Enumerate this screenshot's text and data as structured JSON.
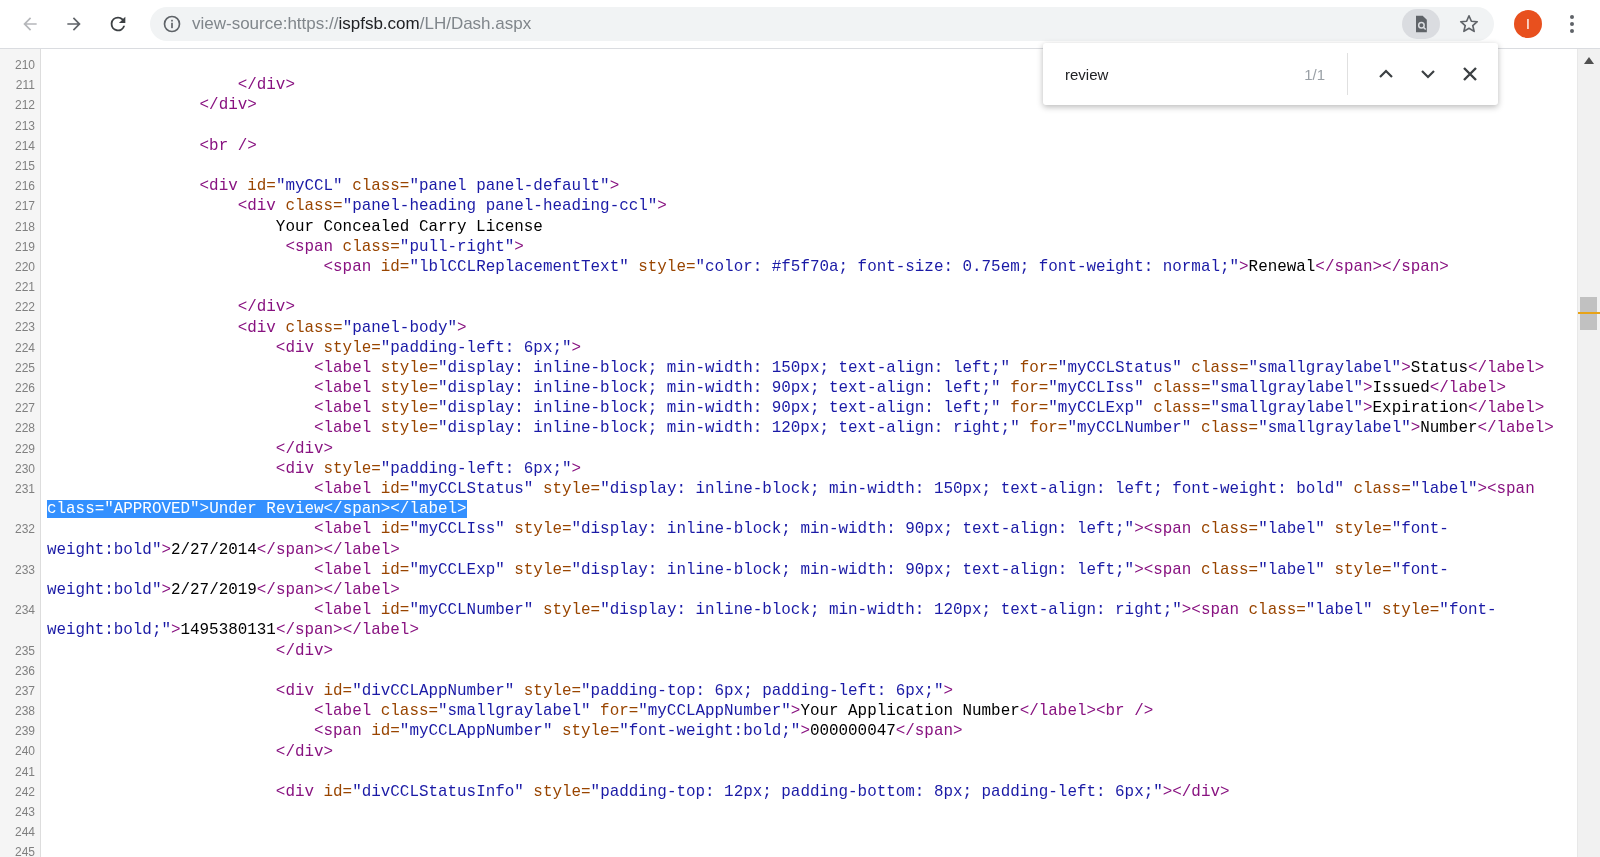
{
  "toolbar": {
    "url": {
      "prefix": "view-source:https://",
      "host": "ispfsb.com",
      "path": "/LH/Dash.aspx"
    },
    "back_disabled": true,
    "forward_disabled": false,
    "avatar": "I"
  },
  "find_bar": {
    "value": "review",
    "count": "1/1"
  },
  "source": {
    "lines": [
      {
        "number": "210"
      },
      {
        "number": "211",
        "rows": [
          {
            "highlighted": false,
            "tokens": [
              {
                "kind": "tag",
                "text": "                    </div>"
              }
            ]
          }
        ]
      },
      {
        "number": "212",
        "rows": [
          {
            "highlighted": false,
            "tokens": [
              {
                "kind": "tag",
                "text": "                </div>"
              }
            ]
          }
        ]
      },
      {
        "number": "213"
      },
      {
        "number": "214",
        "rows": [
          {
            "highlighted": false,
            "tokens": [
              {
                "kind": "tag",
                "text": "                <br />"
              }
            ]
          }
        ]
      },
      {
        "number": "215"
      },
      {
        "number": "216",
        "rows": [
          {
            "highlighted": false,
            "tokens": [
              {
                "kind": "tag",
                "text": "                <div"
              },
              {
                "kind": "attr",
                "text": " id="
              },
              {
                "kind": "val",
                "text": "\"myCCL\""
              },
              {
                "kind": "attr",
                "text": " class="
              },
              {
                "kind": "val",
                "text": "\"panel panel-default\""
              },
              {
                "kind": "tag",
                "text": ">"
              }
            ]
          }
        ]
      },
      {
        "number": "217",
        "rows": [
          {
            "highlighted": false,
            "tokens": [
              {
                "kind": "tag",
                "text": "                    <div"
              },
              {
                "kind": "attr",
                "text": " class="
              },
              {
                "kind": "val",
                "text": "\"panel-heading panel-heading-ccl\""
              },
              {
                "kind": "tag",
                "text": ">"
              }
            ]
          }
        ]
      },
      {
        "number": "218",
        "rows": [
          {
            "highlighted": false,
            "tokens": [
              {
                "kind": "text",
                "text": "                        Your Concealed Carry License"
              }
            ]
          }
        ]
      },
      {
        "number": "219",
        "rows": [
          {
            "highlighted": false,
            "tokens": [
              {
                "kind": "tag",
                "text": "                         <span"
              },
              {
                "kind": "attr",
                "text": " class="
              },
              {
                "kind": "val",
                "text": "\"pull-right\""
              },
              {
                "kind": "tag",
                "text": ">"
              }
            ]
          }
        ]
      },
      {
        "number": "220",
        "rows": [
          {
            "highlighted": false,
            "tokens": [
              {
                "kind": "tag",
                "text": "                             <span"
              },
              {
                "kind": "attr",
                "text": " id="
              },
              {
                "kind": "val",
                "text": "\"lblCCLReplacementText\""
              },
              {
                "kind": "attr",
                "text": " style="
              },
              {
                "kind": "val",
                "text": "\"color: #f5f70a; font-size: 0.75em; font-weight: normal;\""
              },
              {
                "kind": "tag",
                "text": ">"
              },
              {
                "kind": "text",
                "text": "Renewal"
              },
              {
                "kind": "tag",
                "text": "</span></span>"
              }
            ]
          }
        ]
      },
      {
        "number": "221"
      },
      {
        "number": "222",
        "rows": [
          {
            "highlighted": false,
            "tokens": [
              {
                "kind": "tag",
                "text": "                    </div>"
              }
            ]
          }
        ]
      },
      {
        "number": "223",
        "rows": [
          {
            "highlighted": false,
            "tokens": [
              {
                "kind": "tag",
                "text": "                    <div"
              },
              {
                "kind": "attr",
                "text": " class="
              },
              {
                "kind": "val",
                "text": "\"panel-body\""
              },
              {
                "kind": "tag",
                "text": ">"
              }
            ]
          }
        ]
      },
      {
        "number": "224",
        "rows": [
          {
            "highlighted": false,
            "tokens": [
              {
                "kind": "tag",
                "text": "                        <div"
              },
              {
                "kind": "attr",
                "text": " style="
              },
              {
                "kind": "val",
                "text": "\"padding-left: 6px;\""
              },
              {
                "kind": "tag",
                "text": ">"
              }
            ]
          }
        ]
      },
      {
        "number": "225",
        "rows": [
          {
            "highlighted": false,
            "tokens": [
              {
                "kind": "tag",
                "text": "                            <label"
              },
              {
                "kind": "attr",
                "text": " style="
              },
              {
                "kind": "val",
                "text": "\"display: inline-block; min-width: 150px; text-align: left;\""
              },
              {
                "kind": "attr",
                "text": " for="
              },
              {
                "kind": "val",
                "text": "\"myCCLStatus\""
              },
              {
                "kind": "attr",
                "text": " class="
              },
              {
                "kind": "val",
                "text": "\"smallgraylabel\""
              },
              {
                "kind": "tag",
                "text": ">"
              },
              {
                "kind": "text",
                "text": "Status"
              },
              {
                "kind": "tag",
                "text": "</label>"
              }
            ]
          }
        ]
      },
      {
        "number": "226",
        "rows": [
          {
            "highlighted": false,
            "tokens": [
              {
                "kind": "tag",
                "text": "                            <label"
              },
              {
                "kind": "attr",
                "text": " style="
              },
              {
                "kind": "val",
                "text": "\"display: inline-block; min-width: 90px; text-align: left;\""
              },
              {
                "kind": "attr",
                "text": " for="
              },
              {
                "kind": "val",
                "text": "\"myCCLIss\""
              },
              {
                "kind": "attr",
                "text": " class="
              },
              {
                "kind": "val",
                "text": "\"smallgraylabel\""
              },
              {
                "kind": "tag",
                "text": ">"
              },
              {
                "kind": "text",
                "text": "Issued"
              },
              {
                "kind": "tag",
                "text": "</label>"
              }
            ]
          }
        ]
      },
      {
        "number": "227",
        "rows": [
          {
            "highlighted": false,
            "tokens": [
              {
                "kind": "tag",
                "text": "                            <label"
              },
              {
                "kind": "attr",
                "text": " style="
              },
              {
                "kind": "val",
                "text": "\"display: inline-block; min-width: 90px; text-align: left;\""
              },
              {
                "kind": "attr",
                "text": " for="
              },
              {
                "kind": "val",
                "text": "\"myCCLExp\""
              },
              {
                "kind": "attr",
                "text": " class="
              },
              {
                "kind": "val",
                "text": "\"smallgraylabel\""
              },
              {
                "kind": "tag",
                "text": ">"
              },
              {
                "kind": "text",
                "text": "Expiration"
              },
              {
                "kind": "tag",
                "text": "</label>"
              }
            ]
          }
        ]
      },
      {
        "number": "228",
        "rows": [
          {
            "highlighted": false,
            "tokens": [
              {
                "kind": "tag",
                "text": "                            <label"
              },
              {
                "kind": "attr",
                "text": " style="
              },
              {
                "kind": "val",
                "text": "\"display: inline-block; min-width: 120px; text-align: right;\""
              },
              {
                "kind": "attr",
                "text": " for="
              },
              {
                "kind": "val",
                "text": "\"myCCLNumber\""
              },
              {
                "kind": "attr",
                "text": " class="
              },
              {
                "kind": "val",
                "text": "\"smallgraylabel\""
              },
              {
                "kind": "tag",
                "text": ">"
              },
              {
                "kind": "text",
                "text": "Number"
              },
              {
                "kind": "tag",
                "text": "</label>"
              }
            ]
          }
        ]
      },
      {
        "number": "229",
        "rows": [
          {
            "highlighted": false,
            "tokens": [
              {
                "kind": "tag",
                "text": "                        </div>"
              }
            ]
          }
        ]
      },
      {
        "number": "230",
        "rows": [
          {
            "highlighted": false,
            "tokens": [
              {
                "kind": "tag",
                "text": "                        <div"
              },
              {
                "kind": "attr",
                "text": " style="
              },
              {
                "kind": "val",
                "text": "\"padding-left: 6px;\""
              },
              {
                "kind": "tag",
                "text": ">"
              }
            ]
          }
        ]
      },
      {
        "number": "231",
        "rows": [
          {
            "highlighted": false,
            "tokens": [
              {
                "kind": "tag",
                "text": "                            <label"
              },
              {
                "kind": "attr",
                "text": " id="
              },
              {
                "kind": "val",
                "text": "\"myCCLStatus\""
              },
              {
                "kind": "attr",
                "text": " style="
              },
              {
                "kind": "val",
                "text": "\"display: inline-block; min-width: 150px; text-align: left; font-weight: bold\""
              },
              {
                "kind": "attr",
                "text": " class="
              },
              {
                "kind": "val",
                "text": "\"label\""
              },
              {
                "kind": "tag",
                "text": "><span"
              }
            ]
          },
          {
            "highlighted": true,
            "tokens": [
              {
                "kind": "attr",
                "text": "class="
              },
              {
                "kind": "val",
                "text": "\"APPROVED\""
              },
              {
                "kind": "tag",
                "text": ">"
              },
              {
                "kind": "text",
                "text": "Under Review"
              },
              {
                "kind": "tag",
                "text": "</span></label>"
              }
            ]
          }
        ]
      },
      {
        "number": "232",
        "rows": [
          {
            "highlighted": false,
            "tokens": [
              {
                "kind": "tag",
                "text": "                            <label"
              },
              {
                "kind": "attr",
                "text": " id="
              },
              {
                "kind": "val",
                "text": "\"myCCLIss\""
              },
              {
                "kind": "attr",
                "text": " style="
              },
              {
                "kind": "val",
                "text": "\"display: inline-block; min-width: 90px; text-align: left;\""
              },
              {
                "kind": "tag",
                "text": "><span"
              },
              {
                "kind": "attr",
                "text": " class="
              },
              {
                "kind": "val",
                "text": "\"label\""
              },
              {
                "kind": "attr",
                "text": " style="
              },
              {
                "kind": "val",
                "text": "\"font-"
              }
            ]
          },
          {
            "highlighted": false,
            "tokens": [
              {
                "kind": "val",
                "text": "weight:bold\""
              },
              {
                "kind": "tag",
                "text": ">"
              },
              {
                "kind": "text",
                "text": "2/27/2014"
              },
              {
                "kind": "tag",
                "text": "</span></label>"
              }
            ]
          }
        ]
      },
      {
        "number": "233",
        "rows": [
          {
            "highlighted": false,
            "tokens": [
              {
                "kind": "tag",
                "text": "                            <label"
              },
              {
                "kind": "attr",
                "text": " id="
              },
              {
                "kind": "val",
                "text": "\"myCCLExp\""
              },
              {
                "kind": "attr",
                "text": " style="
              },
              {
                "kind": "val",
                "text": "\"display: inline-block; min-width: 90px; text-align: left;\""
              },
              {
                "kind": "tag",
                "text": "><span"
              },
              {
                "kind": "attr",
                "text": " class="
              },
              {
                "kind": "val",
                "text": "\"label\""
              },
              {
                "kind": "attr",
                "text": " style="
              },
              {
                "kind": "val",
                "text": "\"font-"
              }
            ]
          },
          {
            "highlighted": false,
            "tokens": [
              {
                "kind": "val",
                "text": "weight:bold\""
              },
              {
                "kind": "tag",
                "text": ">"
              },
              {
                "kind": "text",
                "text": "2/27/2019"
              },
              {
                "kind": "tag",
                "text": "</span></label>"
              }
            ]
          }
        ]
      },
      {
        "number": "234",
        "rows": [
          {
            "highlighted": false,
            "tokens": [
              {
                "kind": "tag",
                "text": "                            <label"
              },
              {
                "kind": "attr",
                "text": " id="
              },
              {
                "kind": "val",
                "text": "\"myCCLNumber\""
              },
              {
                "kind": "attr",
                "text": " style="
              },
              {
                "kind": "val",
                "text": "\"display: inline-block; min-width: 120px; text-align: right;\""
              },
              {
                "kind": "tag",
                "text": "><span"
              },
              {
                "kind": "attr",
                "text": " class="
              },
              {
                "kind": "val",
                "text": "\"label\""
              },
              {
                "kind": "attr",
                "text": " style="
              },
              {
                "kind": "val",
                "text": "\"font-"
              }
            ]
          },
          {
            "highlighted": false,
            "tokens": [
              {
                "kind": "val",
                "text": "weight:bold;\""
              },
              {
                "kind": "tag",
                "text": ">"
              },
              {
                "kind": "text",
                "text": "1495380131"
              },
              {
                "kind": "tag",
                "text": "</span></label>"
              }
            ]
          }
        ]
      },
      {
        "number": "235",
        "rows": [
          {
            "highlighted": false,
            "tokens": [
              {
                "kind": "tag",
                "text": "                        </div>"
              }
            ]
          }
        ]
      },
      {
        "number": "236"
      },
      {
        "number": "237",
        "rows": [
          {
            "highlighted": false,
            "tokens": [
              {
                "kind": "tag",
                "text": "                        <div"
              },
              {
                "kind": "attr",
                "text": " id="
              },
              {
                "kind": "val",
                "text": "\"divCCLAppNumber\""
              },
              {
                "kind": "attr",
                "text": " style="
              },
              {
                "kind": "val",
                "text": "\"padding-top: 6px; padding-left: 6px;\""
              },
              {
                "kind": "tag",
                "text": ">"
              }
            ]
          }
        ]
      },
      {
        "number": "238",
        "rows": [
          {
            "highlighted": false,
            "tokens": [
              {
                "kind": "tag",
                "text": "                            <label"
              },
              {
                "kind": "attr",
                "text": " class="
              },
              {
                "kind": "val",
                "text": "\"smallgraylabel\""
              },
              {
                "kind": "attr",
                "text": " for="
              },
              {
                "kind": "val",
                "text": "\"myCCLAppNumber\""
              },
              {
                "kind": "tag",
                "text": ">"
              },
              {
                "kind": "text",
                "text": "Your Application Number"
              },
              {
                "kind": "tag",
                "text": "</label><br />"
              }
            ]
          }
        ]
      },
      {
        "number": "239",
        "rows": [
          {
            "highlighted": false,
            "tokens": [
              {
                "kind": "tag",
                "text": "                            <span"
              },
              {
                "kind": "attr",
                "text": " id="
              },
              {
                "kind": "val",
                "text": "\"myCCLAppNumber\""
              },
              {
                "kind": "attr",
                "text": " style="
              },
              {
                "kind": "val",
                "text": "\"font-weight:bold;\""
              },
              {
                "kind": "tag",
                "text": ">"
              },
              {
                "kind": "text",
                "text": "000000047"
              },
              {
                "kind": "tag",
                "text": "</span>"
              }
            ]
          }
        ]
      },
      {
        "number": "240",
        "rows": [
          {
            "highlighted": false,
            "tokens": [
              {
                "kind": "tag",
                "text": "                        </div>"
              }
            ]
          }
        ]
      },
      {
        "number": "241"
      },
      {
        "number": "242",
        "rows": [
          {
            "highlighted": false,
            "tokens": [
              {
                "kind": "tag",
                "text": "                        <div"
              },
              {
                "kind": "attr",
                "text": " id="
              },
              {
                "kind": "val",
                "text": "\"divCCLStatusInfo\""
              },
              {
                "kind": "attr",
                "text": " style="
              },
              {
                "kind": "val",
                "text": "\"padding-top: 12px; padding-bottom: 8px; padding-left: 6px;\""
              },
              {
                "kind": "tag",
                "text": "></div>"
              }
            ]
          }
        ]
      },
      {
        "number": "243"
      },
      {
        "number": "244"
      },
      {
        "number": "245"
      }
    ]
  }
}
